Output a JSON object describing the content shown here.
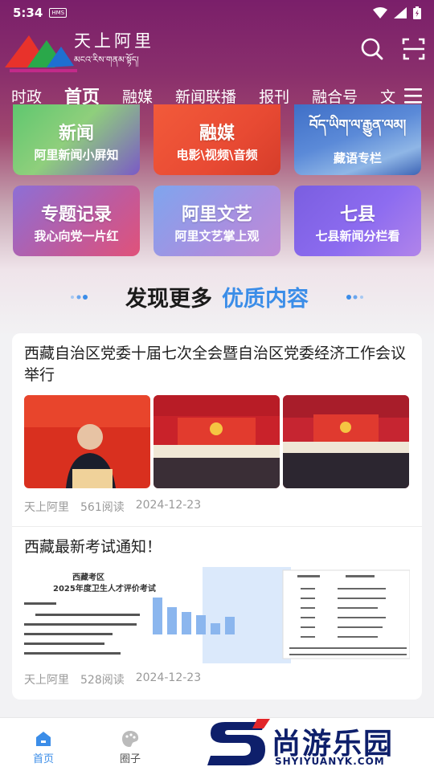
{
  "status_bar": {
    "time": "5:34",
    "sim_badge": "HMS"
  },
  "header": {
    "logo_title": "天上阿里",
    "logo_subtitle": "མངའ་རིས་གནམ་སྟོད།",
    "icons": [
      "search-icon",
      "scan-icon"
    ]
  },
  "nav": {
    "tabs": [
      {
        "label": "时政",
        "active": false
      },
      {
        "label": "首页",
        "active": true
      },
      {
        "label": "融媒",
        "active": false
      },
      {
        "label": "新闻联播",
        "active": false
      },
      {
        "label": "报刊",
        "active": false
      },
      {
        "label": "融合号",
        "active": false
      },
      {
        "label": "文",
        "active": false
      }
    ],
    "menu_icon": "hamburger-icon"
  },
  "grid": [
    {
      "title": "新闻",
      "subtitle": "阿里新闻小屏知"
    },
    {
      "title": "融媒",
      "subtitle": "电影\\视频\\音频"
    },
    {
      "title": "བོད་ཡིག་ལ་རྒྱུན་ལམ།",
      "subtitle": "藏语专栏"
    },
    {
      "title": "专题记录",
      "subtitle": "我心向党一片红"
    },
    {
      "title": "阿里文艺",
      "subtitle": "阿里文艺掌上观"
    },
    {
      "title": "七县",
      "subtitle": "七县新闻分栏看"
    }
  ],
  "discover": {
    "part1": "发现更多",
    "part2": "优质内容"
  },
  "articles": [
    {
      "title": "西藏自治区党委十届七次全会暨自治区党委经济工作会议举行",
      "source": "天上阿里",
      "reads": "561阅读",
      "date": "2024-12-23"
    },
    {
      "title": "西藏最新考试通知！",
      "source": "天上阿里",
      "reads": "528阅读",
      "date": "2024-12-23",
      "doc_lines": [
        "西藏考区",
        "2025年度卫生人才评价考试"
      ]
    }
  ],
  "tab_bar": [
    {
      "label": "首页",
      "icon": "home-icon",
      "active": true
    },
    {
      "label": "圈子",
      "icon": "circle-icon",
      "active": false
    }
  ],
  "watermark": {
    "text": "尚游乐园",
    "url": "SHYIYUANYK.COM"
  },
  "colors": {
    "accent": "#3b8de8",
    "header_purple": "#7a1f6a"
  }
}
